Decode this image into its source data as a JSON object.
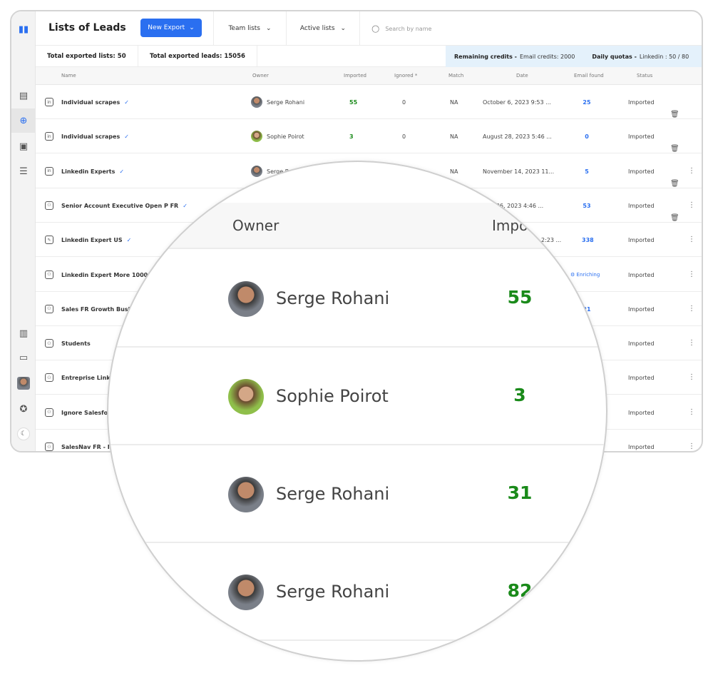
{
  "header": {
    "title": "Lists of Leads",
    "new_export": "New Export",
    "team_lists": "Team lists",
    "active_lists": "Active lists",
    "search_placeholder": "Search by name"
  },
  "stats": {
    "lists": "Total exported lists: 50",
    "leads": "Total exported leads: 15056",
    "credits_label": "Remaining credits -",
    "credits_value": "Email credits: 2000",
    "quota_label": "Daily quotas -",
    "quota_value": "Linkedin : 50 / 80"
  },
  "columns": {
    "name": "Name",
    "owner": "Owner",
    "imported": "Imported",
    "ignored": "Ignored *",
    "match": "Match",
    "date": "Date",
    "email": "Email found",
    "status": "Status"
  },
  "rows": [
    {
      "icon": "in",
      "name": "Individual scrapes",
      "verified": true,
      "owner": "Serge Rohani",
      "imported": "55",
      "ignored": "0",
      "match": "NA",
      "date": "October 6, 2023 9:53 ...",
      "email": "25",
      "status": "Imported"
    },
    {
      "icon": "in",
      "name": "Individual scrapes",
      "verified": true,
      "owner": "Sophie Poirot",
      "imported": "3",
      "ignored": "0",
      "match": "NA",
      "date": "August 28, 2023 5:46 ...",
      "email": "0",
      "status": "Imported"
    },
    {
      "icon": "in",
      "name": "Linkedin Experts",
      "verified": true,
      "owner": "Serge R",
      "match": "NA",
      "date": "November 14, 2023 11...",
      "email": "5",
      "status": "Imported"
    },
    {
      "icon": "group",
      "name": "Senior Account Executive Open P FR",
      "verified": true,
      "date": "ber 26, 2023 4:46 ...",
      "email": "53",
      "status": "Imported"
    },
    {
      "icon": "pen",
      "name": "Linkedin Expert US",
      "verified": true,
      "date": "2:23 ...",
      "email": "338",
      "status": "Imported"
    },
    {
      "icon": "group",
      "name": "Linkedin Expert More 10000",
      "email": "Enriching",
      "status": "Imported"
    },
    {
      "icon": "group",
      "name": "Sales FR Growth Busi",
      "email": "21",
      "status": "Imported"
    },
    {
      "icon": "group",
      "name": "Students",
      "status": "Imported"
    },
    {
      "icon": "group",
      "name": "Entreprise Link",
      "status": "Imported"
    },
    {
      "icon": "group",
      "name": "Ignore Salesfo",
      "status": "Imported"
    },
    {
      "icon": "group",
      "name": "SalesNav FR - I",
      "status": "Imported"
    }
  ],
  "magnifier": {
    "owner_header": "Owner",
    "imported_header": "Impo",
    "rows": [
      {
        "owner": "Serge Rohani",
        "imported": "55"
      },
      {
        "owner": "Sophie Poirot",
        "imported": "3"
      },
      {
        "owner": "Serge Rohani",
        "imported": "31"
      },
      {
        "owner": "Serge Rohani",
        "imported": "82"
      }
    ]
  },
  "colors": {
    "accent": "#2a6ff0",
    "imported_green": "#1a8a1a",
    "credits_bg": "#e4f1fb"
  }
}
